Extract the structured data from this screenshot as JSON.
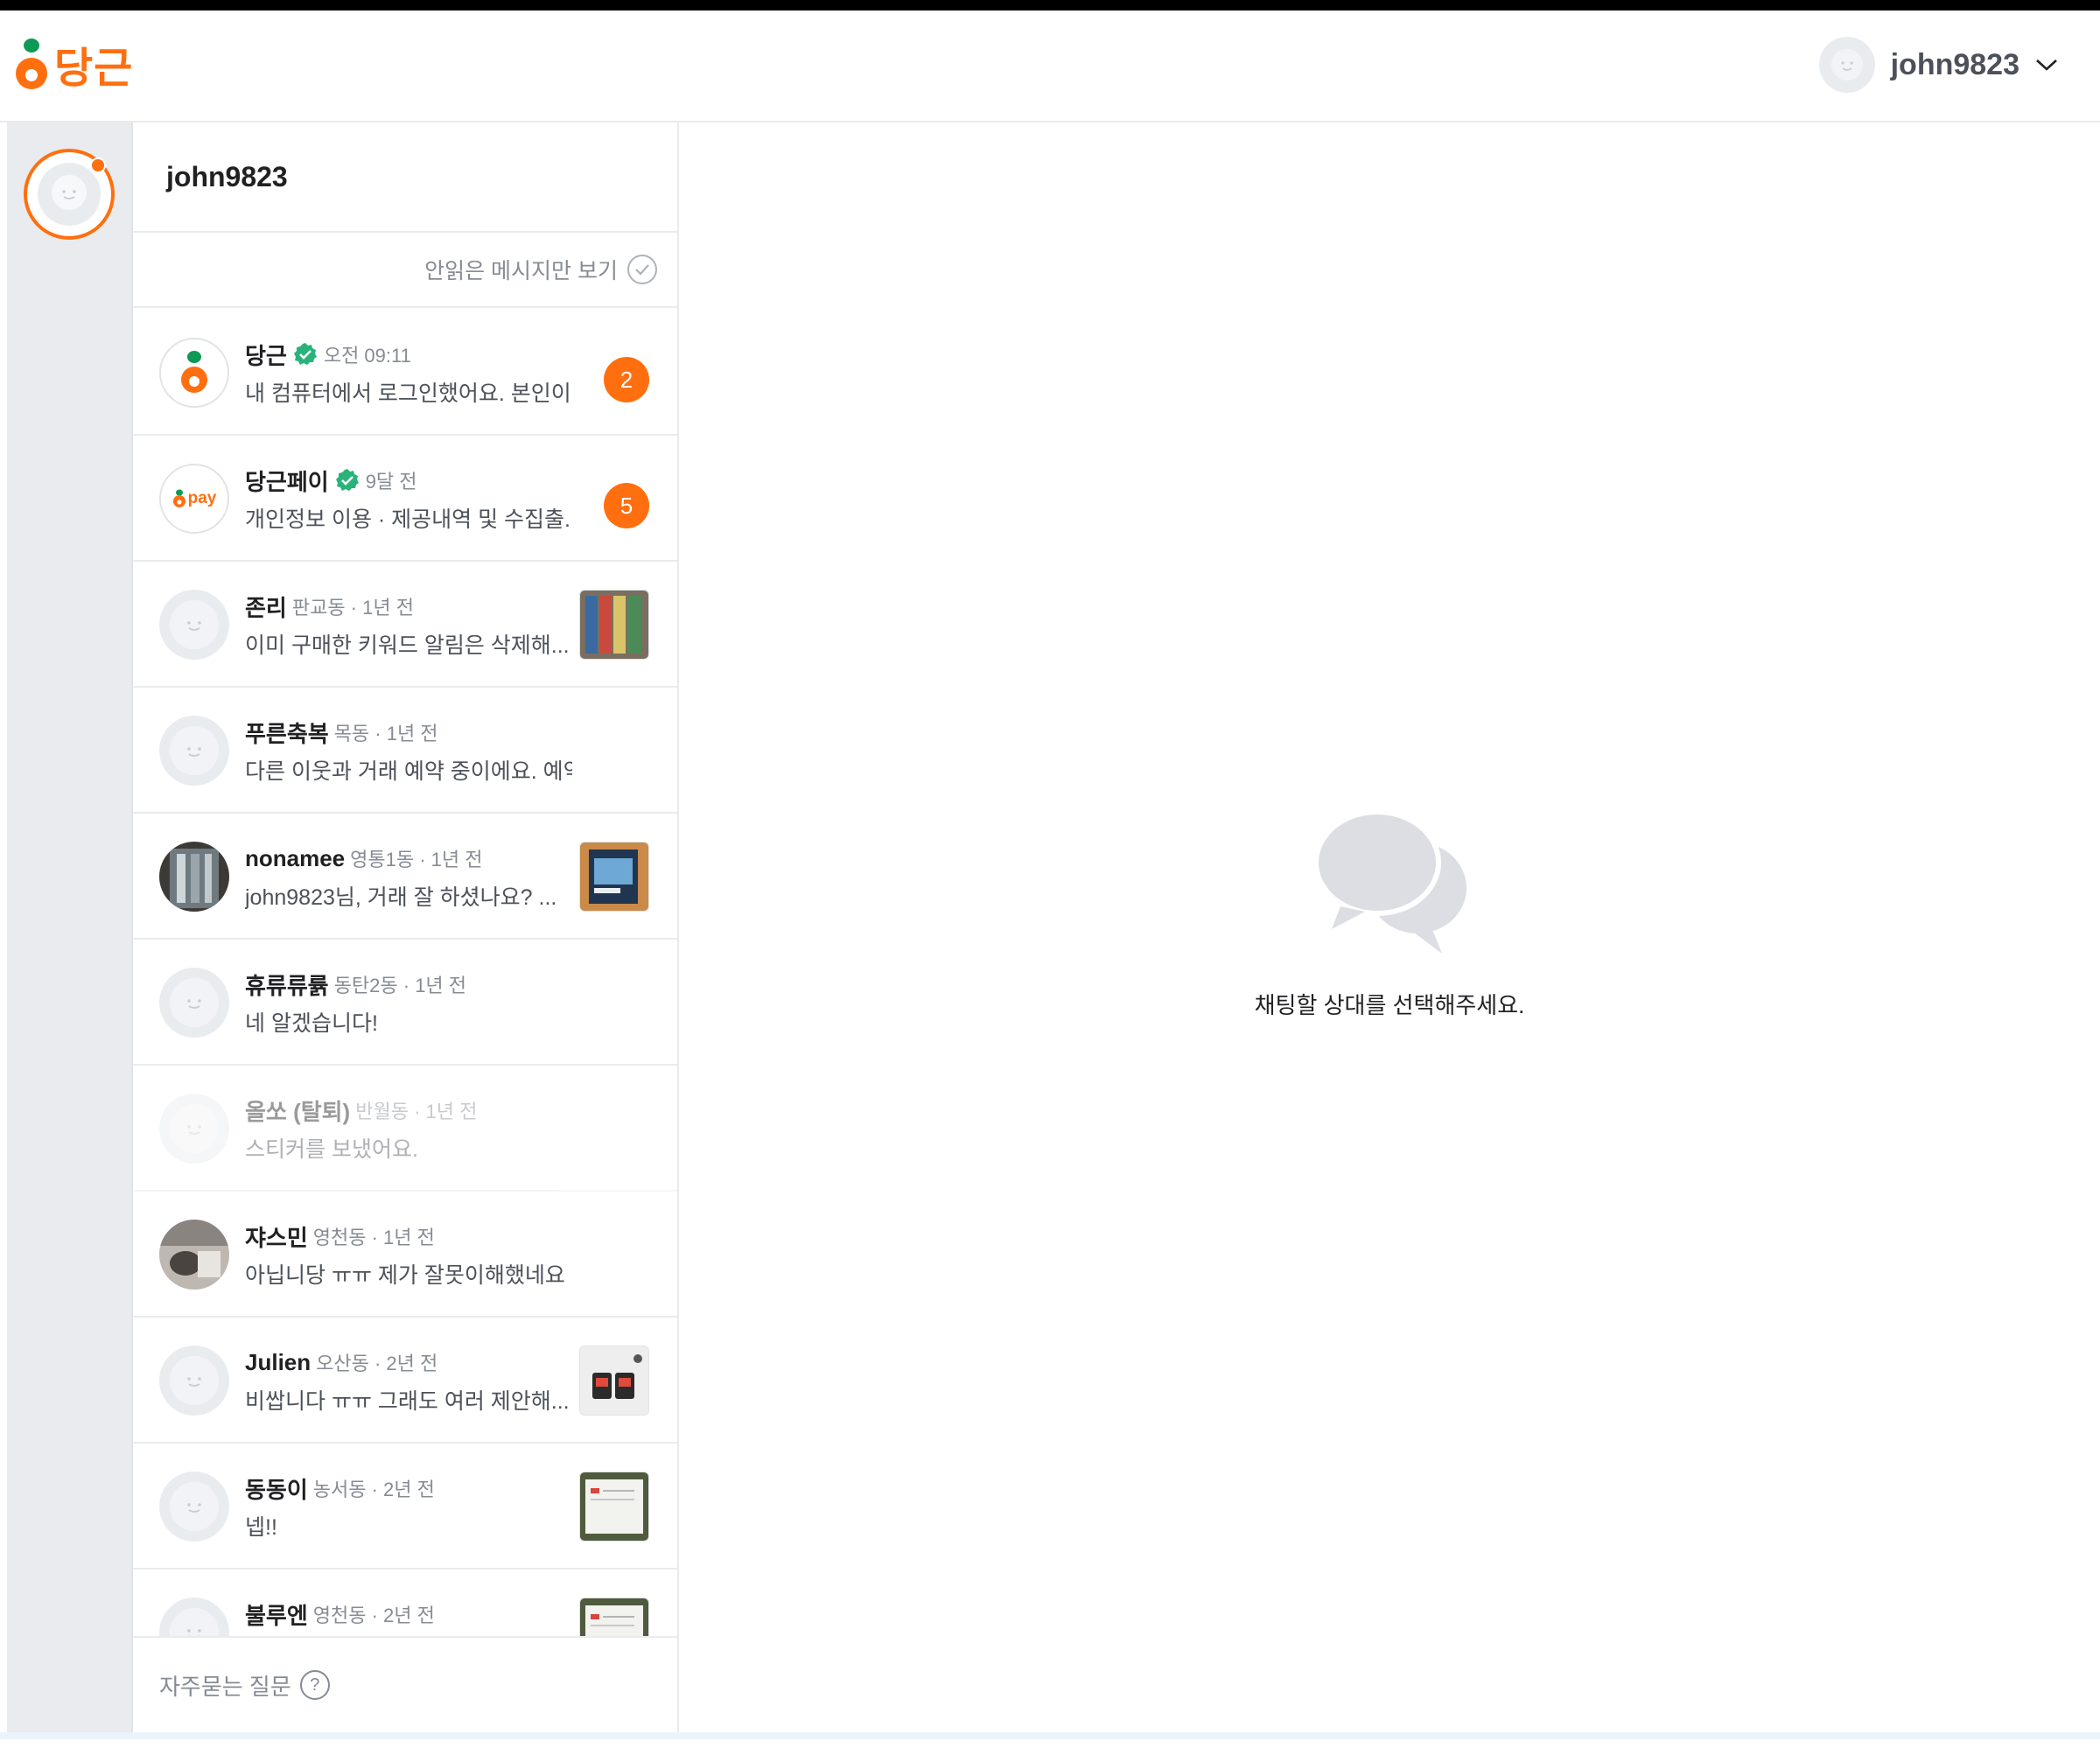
{
  "app": {
    "brand": "당근",
    "accent_color": "#ff6f0f"
  },
  "header": {
    "username": "john9823",
    "menu_icon": "chevron-down-icon"
  },
  "chat_panel": {
    "title": "john9823",
    "filter_label": "안읽은 메시지만 보기",
    "footer_label": "자주묻는 질문"
  },
  "chats": [
    {
      "name": "당근",
      "verified": true,
      "meta": "오전 09:11",
      "message": "내 컴퓨터에서 로그인했어요. 본인이 ...",
      "unread": "2",
      "avatar": "carrot-logo"
    },
    {
      "name": "당근페이",
      "verified": true,
      "meta": "9달 전",
      "message": "개인정보 이용 · 제공내역 및 수집출...",
      "unread": "5",
      "avatar": "pay-logo",
      "avatar_text": "pay"
    },
    {
      "name": "존리",
      "meta": "판교동 · 1년 전",
      "message": "이미 구매한 키워드 알림은 삭제해...",
      "avatar": "default",
      "thumb": "shelf"
    },
    {
      "name": "푸른축복",
      "meta": "목동 · 1년 전",
      "message": "다른 이웃과 거래 예약 중이에요. 예약이 취소...",
      "avatar": "default"
    },
    {
      "name": "nonamee",
      "meta": "영통1동 · 1년 전",
      "message": "john9823님, 거래 잘 하셨나요? ...",
      "avatar": "photo",
      "thumb": "book"
    },
    {
      "name": "휴류류륡",
      "meta": "동탄2동 · 1년 전",
      "message": "네 알겠습니다!",
      "avatar": "default"
    },
    {
      "name": "올쏘 (탈퇴)",
      "meta": "반월동 · 1년 전",
      "message": "스티커를 보냈어요.",
      "avatar": "default",
      "faded": true
    },
    {
      "name": "쟈스민",
      "meta": "영천동 · 1년 전",
      "message": "아닙니당 ㅠㅠ 제가 잘못이해했네요 좋은 하...",
      "avatar": "photo2"
    },
    {
      "name": "Julien",
      "meta": "오산동 · 2년 전",
      "message": "비쌉니다 ㅠㅠ 그래도 여러 제안해...",
      "avatar": "default",
      "thumb": "device"
    },
    {
      "name": "동동이",
      "meta": "농서동 · 2년 전",
      "message": "넵!!",
      "avatar": "default",
      "thumb": "paper"
    },
    {
      "name": "불루엔",
      "meta": "영천동 · 2년 전",
      "message": "",
      "avatar": "default",
      "thumb": "paper"
    }
  ],
  "empty_state": {
    "message": "채팅할 상대를 선택해주세요.",
    "icon": "chat-bubbles-icon"
  }
}
